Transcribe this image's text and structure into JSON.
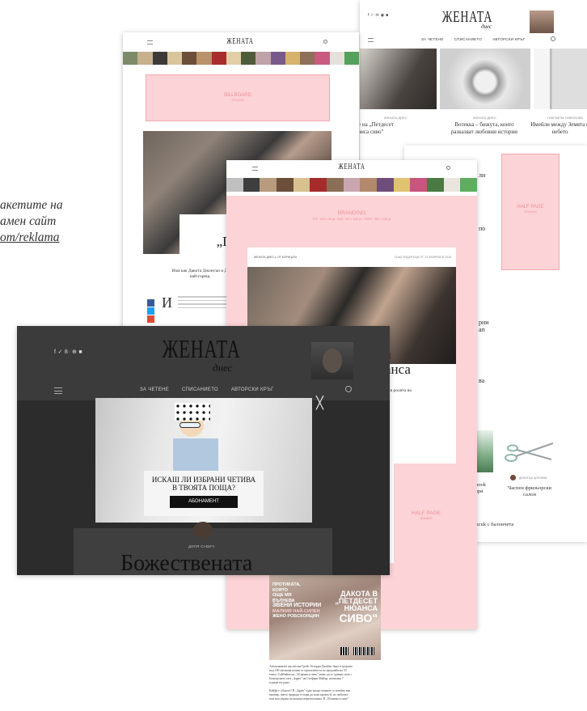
{
  "left_text": {
    "line1": "акетите на",
    "line2": "амен сайт",
    "line3": "om/reklama"
  },
  "shot_top_right": {
    "social": "f ✓ ✉ ◉ ■",
    "logo": "ЖЕНАТА",
    "logo_sub": "днес",
    "nav": [
      "ЗА ЧЕТЕНЕ",
      "СПИСАНИЕТО",
      "АВТОРСКИ КРЪГ"
    ],
    "card1_meta": "ЖЕНАТА ДНЕС",
    "card1_title_l1": "е на „Петдесет",
    "card1_title_l2": "анса сиво\"",
    "card2_meta": "ЖЕНАТА ДНЕС",
    "card2_title_l1": "Вотекка – бижута, които",
    "card2_title_l2": "разказват любовни истории",
    "card3_meta": "ГАБРИЕЛА НИКОЛОВА",
    "card3_title_l1": "Имейли между Земята и",
    "card3_title_l2": "небето",
    "half_page": "HALF PAGE",
    "half_page_sub": "300x600",
    "side_frag1": "ли",
    "side_frag2": "по",
    "side_frag3": "рии",
    "side_frag4": "ап",
    "side_frag5": "ва",
    "author2": "ДЕНИТЦА ЦОНЧЕВА",
    "card4_title_l1": "Часпен фризьорски",
    "card4_title_l2": "салон",
    "card5_frag1": "book",
    "card5_frag2": "ари",
    "card6_title": "Dacuk с балончета"
  },
  "shot_second": {
    "logo": "ЖЕНАТА",
    "billboard": "BILLBOARD",
    "billboard_sub": "970x250",
    "headline_l1": "Звез",
    "headline_l2": "„Петдес",
    "headline_l3": "с",
    "subline_l1": "Има как Дакота Джонсън и Д",
    "subline_l2": "най-горещ",
    "body_letter": "И",
    "pink_tag": "АКЦИЯ"
  },
  "shot_branding": {
    "logo": "ЖЕНАТА",
    "branding": "BRANDING",
    "branding_sub": "TOP · 1920 × 80 px  ·  SIDE · 300 × 1080 px  ·  RIGHT · 860 × 1080 px",
    "crumb": "ЖЕНАТА ДНЕС ▸ ОТ КОРИЦАТА",
    "date": "СНАЗ ПОДАРЪЦИ ОТ: 11 ФЕВРУАРИ 2015",
    "headline_l1": "а",
    "headline_l2": "анса",
    "sub_frag": "зая в ролята на",
    "half_page": "HALF PAGE",
    "half_page_sub": "300x600",
    "magazine_l1": "ДАКОТА В",
    "magazine_l2": "„ПЕТДЕСЕТ",
    "magazine_l3": "НЮАНСА",
    "magazine_l4": "СИВО\"",
    "magazine_left_l1": "ПРОТИКАТА,",
    "magazine_left_l2": "КОЯТО",
    "magazine_left_l3": "ОЩЕ МЯ",
    "magazine_left_l4": "ВЪЛНЕВА",
    "magazine_left_l5": "ЗВЕНИ ИСТОРИИ",
    "magazine_left_l6": "МАЛКИЯ НАЙ-СИЛЕН",
    "magazine_left_l7": "ЖЕНО РОБСКОНЦИН",
    "caption_l1": "Автоклавната писателка Грейс Аттерри Джеймс бяна в трорчна",
    "caption_l2": "под 100 милиона копия от трилогиятота по продажби на 55",
    "caption_l3": "езика. Сайбайма на „50 нюанса сиво\" може да се сравни само с",
    "caption_l4": "Бенторската сага „Здрач\" на Стефани Майър, написана 7",
    "caption_l5": "години по-рано.",
    "caption_l6": "Кайфе е общото? В „Здрач\" едно малко момиче се влюбва във",
    "caption_l7": "вампир, чието природа го кара да иска кръвта й, но любовта",
    "caption_l8": "към нея държи на кожена неразположна. В „50 нюанса сиво\""
  },
  "shot_popup": {
    "social": "f  ✓  8·  ⊕  ■",
    "logo": "ЖЕНАТА",
    "logo_sub": "днес",
    "nav": [
      "ЗА ЧЕТЕНЕ",
      "СПИСАНИЕТО",
      "АВТОРСКИ КРЪГ"
    ],
    "modal_title_l1": "ИСКАШ ЛИ ИЗБРАНИ ЧЕТИВА",
    "modal_title_l2": "В ТВОЯТА ПОЩА?",
    "modal_button": "АБОНАМЕНТ",
    "author": "ДИЛЯ САВИЧ",
    "article_title": "Божествената",
    "close_symbol": "╳"
  },
  "colors": {
    "pink_ad": "#fcd3d6",
    "pink_border": "#f3a9b0",
    "pink_text": "#ee8f99",
    "dark_overlay": "#3b3b3b",
    "modal_button": "#111111",
    "link_red": "#d0393f"
  }
}
